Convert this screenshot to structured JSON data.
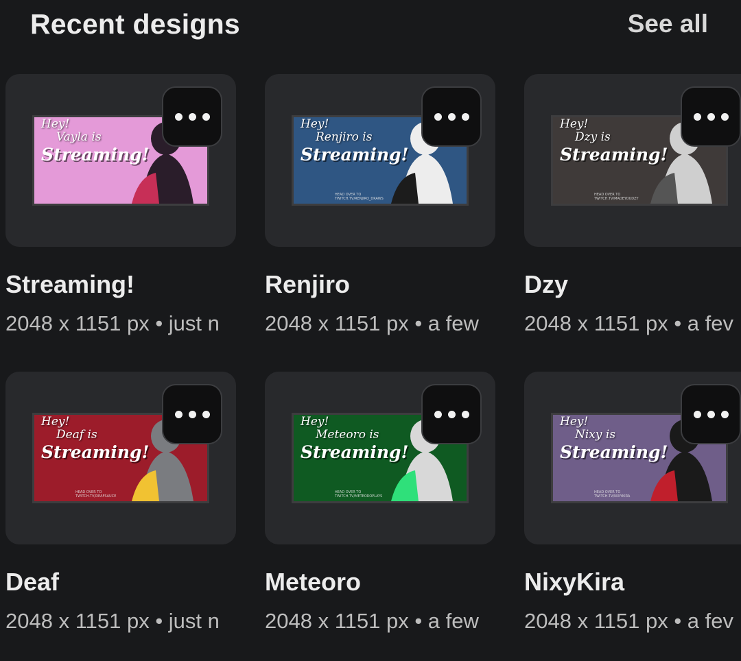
{
  "header": {
    "title": "Recent designs",
    "see_all": "See all"
  },
  "designs": [
    {
      "title": "Streaming!",
      "meta": "2048 x 1151 px • just n",
      "thumb": {
        "hey": "Hey!",
        "name": "Vayla is",
        "streaming": "Streaming!",
        "small": "",
        "bg": "#e49ad8",
        "fig": "#2a1d2a",
        "accent": "#c72f57"
      }
    },
    {
      "title": "Renjiro",
      "meta": "2048 x 1151 px • a few",
      "thumb": {
        "hey": "Hey!",
        "name": "Renjiro is",
        "streaming": "Streaming!",
        "small": "HEAD OVER TO\nTWITCH.TV/RENJIRO_DRAWS",
        "bg": "#2f5683",
        "fig": "#ededed",
        "accent": "#1c1c1c"
      }
    },
    {
      "title": "Dzy",
      "meta": "2048 x 1151 px • a fev",
      "thumb": {
        "hey": "Hey!",
        "name": "Dzy is",
        "streaming": "Streaming!",
        "small": "HEAD OVER TO\nTWITCH.TV/MADEYOUDZY",
        "bg": "#3f3a39",
        "fig": "#cfcfcf",
        "accent": "#555555"
      }
    },
    {
      "title": "Deaf",
      "meta": "2048 x 1151 px • just n",
      "thumb": {
        "hey": "Hey!",
        "name": "Deaf is",
        "streaming": "Streaming!",
        "small": "HEAD OVER TO\nTWITCH.TV/DEAFSAUCE",
        "bg": "#9c1c2a",
        "fig": "#7a7c80",
        "accent": "#f1c232"
      }
    },
    {
      "title": "Meteoro",
      "meta": "2048 x 1151 px • a few",
      "thumb": {
        "hey": "Hey!",
        "name": "Meteoro is",
        "streaming": "Streaming!",
        "small": "HEAD OVER TO\nTWITCH.TV/METEOROPLAYS",
        "bg": "#0f5a22",
        "fig": "#d8d8d8",
        "accent": "#2fe07a"
      }
    },
    {
      "title": "NixyKira",
      "meta": "2048 x 1151 px • a fev",
      "thumb": {
        "hey": "Hey!",
        "name": "Nixy is",
        "streaming": "Streaming!",
        "small": "HEAD OVER TO\nTWITCH.TV/NIXYKIRA",
        "bg": "#6f5e89",
        "fig": "#1a1a1a",
        "accent": "#c01f2c"
      }
    }
  ]
}
